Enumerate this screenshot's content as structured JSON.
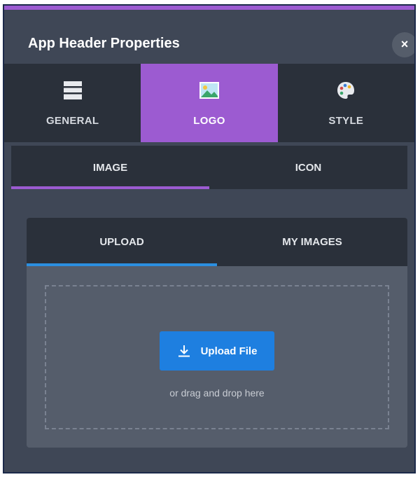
{
  "dialog": {
    "title": "App Header Properties",
    "close_label": "×"
  },
  "main_tabs": [
    {
      "label": "GENERAL",
      "icon": "general-layout-icon",
      "active": false
    },
    {
      "label": "LOGO",
      "icon": "image-icon",
      "active": true
    },
    {
      "label": "STYLE",
      "icon": "palette-icon",
      "active": false
    }
  ],
  "sub_tabs": [
    {
      "label": "IMAGE",
      "active": true
    },
    {
      "label": "ICON",
      "active": false
    }
  ],
  "upload_tabs": [
    {
      "label": "UPLOAD",
      "active": true
    },
    {
      "label": "MY IMAGES",
      "active": false
    }
  ],
  "dropzone": {
    "button_label": "Upload File",
    "button_icon": "download-icon",
    "hint": "or drag and drop here"
  },
  "colors": {
    "accent_purple": "#9c5bd1",
    "accent_blue": "#1e7fe0",
    "panel_dark": "#2a303a",
    "panel": "#3f4756"
  }
}
